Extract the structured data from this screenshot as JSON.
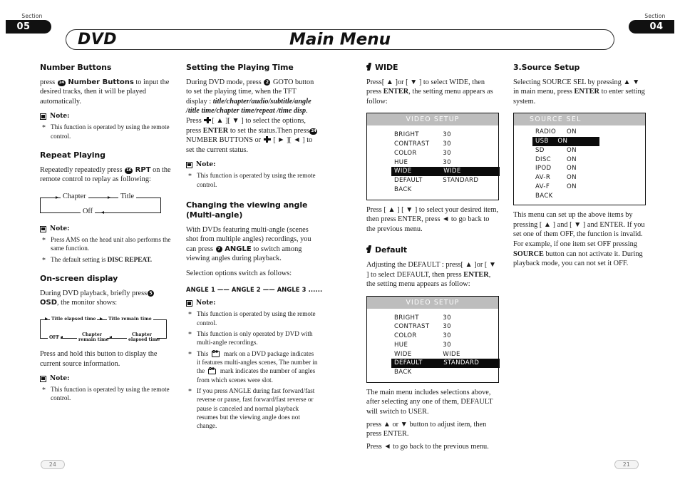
{
  "header": {
    "section_word_left": "Section",
    "section_left": "05",
    "section_word_right": "Section",
    "section_right": "04",
    "title_left": "DVD",
    "title_center": "Main Menu"
  },
  "col1": {
    "h1": "Number Buttons",
    "p1_a": "press",
    "p1_key": "24",
    "p1_b": "Number Buttons",
    "p1_c": "to input the desired tracks, then it will be played automatically.",
    "note_label": "Note:",
    "notes1": [
      "This function is operated by using the remote control."
    ],
    "h2": "Repeat Playing",
    "p2_a": "Repeatedly repeatedly press",
    "p2_key": "16",
    "p2_b": "RPT",
    "p2_c": "on the remote control to replay as following:",
    "flow_repeat": {
      "chapter": "Chapter",
      "title": "Title",
      "off": "Off"
    },
    "notes2": [
      "Press AMS on the head unit also performs the same function.",
      "The default setting is DISC REPEAT."
    ],
    "notes2_bold_tail": "DISC REPEAT.",
    "h3": "On-screen display",
    "p3_a": "During DVD playback, briefly press",
    "p3_key": "5",
    "p3_b": "OSD",
    "p3_c": ", the monitor shows:",
    "flow_osd": {
      "title_elapsed": "Title elapsed time",
      "title_remain": "Title remain time",
      "chapter_elapsed": "Chapter\nelapsed time",
      "chapter_remain": "Chapter\nremain time",
      "off": "OFF"
    },
    "p4": "Press and hold this button to display the current  source information.",
    "notes3": [
      "This function is operated by using the remote control."
    ]
  },
  "col2": {
    "h1": "Setting the Playing Time",
    "p1_a": "During DVD mode, press",
    "p1_key": "2",
    "p1_b": "GOTO button to set the playing time, when the TFT display :",
    "p1_italic": "title/chapter/audio/subtitle/angle /title time/chapter time/repeat /time disp",
    "p1_c": ". Press",
    "p1_keys1": "[ ▲ ][ ▼ ]",
    "p1_d": "to select the options, press",
    "p1_enter": "ENTER",
    "p1_e": "to set the status.Then press",
    "p1_key2": "24",
    "p1_f": "NUMBER BUTTONS or",
    "p1_keys2": "[ ► ][ ◄ ]",
    "p1_g": "to set the current status.",
    "note_label": "Note:",
    "notes1": [
      "This function is operated by using the remote control."
    ],
    "h2": "Changing the viewing angle (Multi-angle)",
    "p2_a": "With DVDs featuring multi-angle (scenes shot from multiple angles) recordings, you can press",
    "p2_key": "7",
    "p2_b": "ANGLE",
    "p2_c": "to switch among viewing angles during playback.",
    "p3": "Selection options switch as follows:",
    "angle_seq": "ANGLE 1 —— ANGLE 2 —— ANGLE 3 ......",
    "notes2_1": "This function is operated by using the remote control.",
    "notes2_2": "This function is only operated by DVD with multi-angle recordings.",
    "notes2_3a": "This",
    "notes2_3b": "mark on a DVD package indicates it features multi-angles scenes, The number in the",
    "notes2_3c": "mark indicates the number of angles from which scenes were slot.",
    "notes2_4": "If you press ANGLE during fast forward/fast reverse or pause, fast forward/fast reverse or pause is canceled and normal playback resumes but the viewing angle does not change."
  },
  "col3": {
    "h1": "WIDE",
    "p1_a": "Press[ ▲ ]or [ ▼ ] to select WIDE, then press",
    "p1_b": "ENTER",
    "p1_c": ", the setting menu appears as follow:",
    "menu1": {
      "title": "VIDEO SETUP",
      "rows": [
        {
          "key": "BRIGHT",
          "value": "30",
          "selected": false
        },
        {
          "key": "CONTRAST",
          "value": "30",
          "selected": false
        },
        {
          "key": "COLOR",
          "value": "30",
          "selected": false
        },
        {
          "key": "HUE",
          "value": "30",
          "selected": false
        },
        {
          "key": "WIDE",
          "value": "WIDE",
          "selected": true
        },
        {
          "key": "DEFAULT",
          "value": "STANDARD",
          "selected": false
        },
        {
          "key": "BACK",
          "value": "",
          "selected": false
        }
      ]
    },
    "p2": "Press [ ▲ ] [ ▼ ] to select your desired item, then press ENTER, press ◄ to go back to the previous menu.",
    "h2": "Default",
    "p3_a": "Adjusting the DEFAULT : press[ ▲ ]or [ ▼ ] to select DEFAULT, then press",
    "p3_b": "ENTER",
    "p3_c": ", the setting menu appears as follow:",
    "menu2": {
      "title": "VIDEO SETUP",
      "rows": [
        {
          "key": "BRIGHT",
          "value": "30",
          "selected": false
        },
        {
          "key": "CONTRAST",
          "value": "30",
          "selected": false
        },
        {
          "key": "COLOR",
          "value": "30",
          "selected": false
        },
        {
          "key": "HUE",
          "value": "30",
          "selected": false
        },
        {
          "key": "WIDE",
          "value": "WIDE",
          "selected": false
        },
        {
          "key": "DEFAULT",
          "value": "STANDARD",
          "selected": true
        },
        {
          "key": "BACK",
          "value": "",
          "selected": false
        }
      ]
    },
    "p4": "The main menu includes selections above, after selecting any one of them, DEFAULT will switch to USER.",
    "p5": "press ▲ or ▼ button to adjust item, then press ENTER.",
    "p6": "Press ◄ to go back to the previous menu."
  },
  "col4": {
    "h1": "3.Source Setup",
    "p1_a": "Selecting SOURCE SEL by pressing ▲ ▼ in main menu, press",
    "p1_b": "ENTER",
    "p1_c": "to enter setting system.",
    "menu": {
      "title": "SOURCE SEL",
      "rows": [
        {
          "key": "RADIO",
          "value": "ON",
          "selected": false
        },
        {
          "key": "USB",
          "value": "ON",
          "selected": true
        },
        {
          "key": "SD",
          "value": "ON",
          "selected": false
        },
        {
          "key": "DISC",
          "value": "ON",
          "selected": false
        },
        {
          "key": "IPOD",
          "value": "ON",
          "selected": false
        },
        {
          "key": "AV-R",
          "value": "ON",
          "selected": false
        },
        {
          "key": "AV-F",
          "value": "ON",
          "selected": false
        },
        {
          "key": "BACK",
          "value": "",
          "selected": false
        }
      ]
    },
    "p2_a": "This menu can set up the above items by pressing [ ▲ ] and [ ▼ ] and ENTER. If you set one of them OFF, the function is invalid. For example, if one item set OFF pressing",
    "p2_b": "SOURCE",
    "p2_c": "button can not activate it. During playback mode, you can not set it OFF."
  },
  "footer": {
    "page_left": "24",
    "page_right": "21"
  },
  "colors": {
    "ink": "#1a1a1a",
    "osd_header_bg": "#bdbdbd",
    "osd_selected_bg": "#0b0b0b",
    "section_pill_bg": "#111111"
  }
}
